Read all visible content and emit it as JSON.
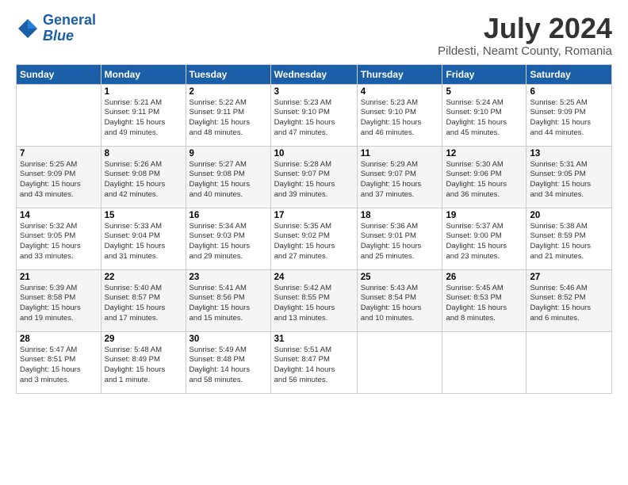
{
  "header": {
    "logo_line1": "General",
    "logo_line2": "Blue",
    "month": "July 2024",
    "location": "Pildesti, Neamt County, Romania"
  },
  "weekdays": [
    "Sunday",
    "Monday",
    "Tuesday",
    "Wednesday",
    "Thursday",
    "Friday",
    "Saturday"
  ],
  "weeks": [
    [
      {
        "day": "",
        "info": ""
      },
      {
        "day": "1",
        "info": "Sunrise: 5:21 AM\nSunset: 9:11 PM\nDaylight: 15 hours\nand 49 minutes."
      },
      {
        "day": "2",
        "info": "Sunrise: 5:22 AM\nSunset: 9:11 PM\nDaylight: 15 hours\nand 48 minutes."
      },
      {
        "day": "3",
        "info": "Sunrise: 5:23 AM\nSunset: 9:10 PM\nDaylight: 15 hours\nand 47 minutes."
      },
      {
        "day": "4",
        "info": "Sunrise: 5:23 AM\nSunset: 9:10 PM\nDaylight: 15 hours\nand 46 minutes."
      },
      {
        "day": "5",
        "info": "Sunrise: 5:24 AM\nSunset: 9:10 PM\nDaylight: 15 hours\nand 45 minutes."
      },
      {
        "day": "6",
        "info": "Sunrise: 5:25 AM\nSunset: 9:09 PM\nDaylight: 15 hours\nand 44 minutes."
      }
    ],
    [
      {
        "day": "7",
        "info": "Sunrise: 5:25 AM\nSunset: 9:09 PM\nDaylight: 15 hours\nand 43 minutes."
      },
      {
        "day": "8",
        "info": "Sunrise: 5:26 AM\nSunset: 9:08 PM\nDaylight: 15 hours\nand 42 minutes."
      },
      {
        "day": "9",
        "info": "Sunrise: 5:27 AM\nSunset: 9:08 PM\nDaylight: 15 hours\nand 40 minutes."
      },
      {
        "day": "10",
        "info": "Sunrise: 5:28 AM\nSunset: 9:07 PM\nDaylight: 15 hours\nand 39 minutes."
      },
      {
        "day": "11",
        "info": "Sunrise: 5:29 AM\nSunset: 9:07 PM\nDaylight: 15 hours\nand 37 minutes."
      },
      {
        "day": "12",
        "info": "Sunrise: 5:30 AM\nSunset: 9:06 PM\nDaylight: 15 hours\nand 36 minutes."
      },
      {
        "day": "13",
        "info": "Sunrise: 5:31 AM\nSunset: 9:05 PM\nDaylight: 15 hours\nand 34 minutes."
      }
    ],
    [
      {
        "day": "14",
        "info": "Sunrise: 5:32 AM\nSunset: 9:05 PM\nDaylight: 15 hours\nand 33 minutes."
      },
      {
        "day": "15",
        "info": "Sunrise: 5:33 AM\nSunset: 9:04 PM\nDaylight: 15 hours\nand 31 minutes."
      },
      {
        "day": "16",
        "info": "Sunrise: 5:34 AM\nSunset: 9:03 PM\nDaylight: 15 hours\nand 29 minutes."
      },
      {
        "day": "17",
        "info": "Sunrise: 5:35 AM\nSunset: 9:02 PM\nDaylight: 15 hours\nand 27 minutes."
      },
      {
        "day": "18",
        "info": "Sunrise: 5:36 AM\nSunset: 9:01 PM\nDaylight: 15 hours\nand 25 minutes."
      },
      {
        "day": "19",
        "info": "Sunrise: 5:37 AM\nSunset: 9:00 PM\nDaylight: 15 hours\nand 23 minutes."
      },
      {
        "day": "20",
        "info": "Sunrise: 5:38 AM\nSunset: 8:59 PM\nDaylight: 15 hours\nand 21 minutes."
      }
    ],
    [
      {
        "day": "21",
        "info": "Sunrise: 5:39 AM\nSunset: 8:58 PM\nDaylight: 15 hours\nand 19 minutes."
      },
      {
        "day": "22",
        "info": "Sunrise: 5:40 AM\nSunset: 8:57 PM\nDaylight: 15 hours\nand 17 minutes."
      },
      {
        "day": "23",
        "info": "Sunrise: 5:41 AM\nSunset: 8:56 PM\nDaylight: 15 hours\nand 15 minutes."
      },
      {
        "day": "24",
        "info": "Sunrise: 5:42 AM\nSunset: 8:55 PM\nDaylight: 15 hours\nand 13 minutes."
      },
      {
        "day": "25",
        "info": "Sunrise: 5:43 AM\nSunset: 8:54 PM\nDaylight: 15 hours\nand 10 minutes."
      },
      {
        "day": "26",
        "info": "Sunrise: 5:45 AM\nSunset: 8:53 PM\nDaylight: 15 hours\nand 8 minutes."
      },
      {
        "day": "27",
        "info": "Sunrise: 5:46 AM\nSunset: 8:52 PM\nDaylight: 15 hours\nand 6 minutes."
      }
    ],
    [
      {
        "day": "28",
        "info": "Sunrise: 5:47 AM\nSunset: 8:51 PM\nDaylight: 15 hours\nand 3 minutes."
      },
      {
        "day": "29",
        "info": "Sunrise: 5:48 AM\nSunset: 8:49 PM\nDaylight: 15 hours\nand 1 minute."
      },
      {
        "day": "30",
        "info": "Sunrise: 5:49 AM\nSunset: 8:48 PM\nDaylight: 14 hours\nand 58 minutes."
      },
      {
        "day": "31",
        "info": "Sunrise: 5:51 AM\nSunset: 8:47 PM\nDaylight: 14 hours\nand 56 minutes."
      },
      {
        "day": "",
        "info": ""
      },
      {
        "day": "",
        "info": ""
      },
      {
        "day": "",
        "info": ""
      }
    ]
  ]
}
